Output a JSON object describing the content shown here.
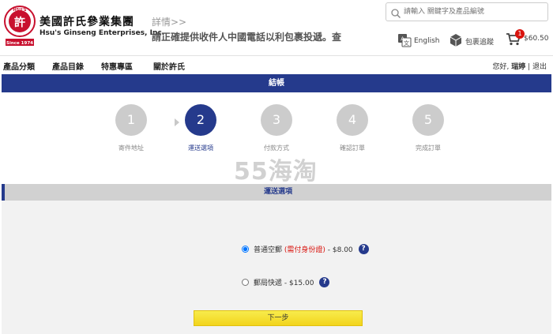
{
  "header": {
    "logo_text_top": "HSU'S",
    "logo_char": "許",
    "logo_text_bottom": "Since 1974",
    "brand_cn": "美國許氏參業集團",
    "brand_en": "Hsu's Ginseng Enterprises, Inc.",
    "notice_head": "詳情>>",
    "notice_body": "請正確提供收件人中國電話以利包裹投遞。查",
    "search_placeholder": "請輸入 關鍵字及產品編號",
    "language_label": "English",
    "track_label": "包裹追蹤",
    "cart_count": "1",
    "cart_total": "$60.50"
  },
  "nav": {
    "items": [
      "產品分類",
      "產品目錄",
      "特惠專區",
      "關於許氏"
    ],
    "greeting": "您好, ",
    "username": "瑞婷",
    "logout": " | 退出"
  },
  "checkout": {
    "title": "結帳",
    "steps": [
      {
        "num": "1",
        "label": "寄件地址"
      },
      {
        "num": "2",
        "label": "運送選項"
      },
      {
        "num": "3",
        "label": "付款方式"
      },
      {
        "num": "4",
        "label": "確認訂單"
      },
      {
        "num": "5",
        "label": "完成訂單"
      }
    ],
    "active_step": 2
  },
  "watermark": "55海淘",
  "shipping": {
    "section_title": "運送選項",
    "options": [
      {
        "prefix": "普通空郵 ",
        "highlight": "(需付身份證)",
        "suffix": " - $8.00",
        "selected": true
      },
      {
        "prefix": "郵局快遞 - $15.00",
        "highlight": "",
        "suffix": "",
        "selected": false
      }
    ],
    "help_symbol": "?",
    "next_label": "下一步"
  },
  "colors": {
    "primary": "#253a8c",
    "badge": "#d9140e",
    "step_inactive": "#cccccc",
    "button": "#f2d41c"
  }
}
